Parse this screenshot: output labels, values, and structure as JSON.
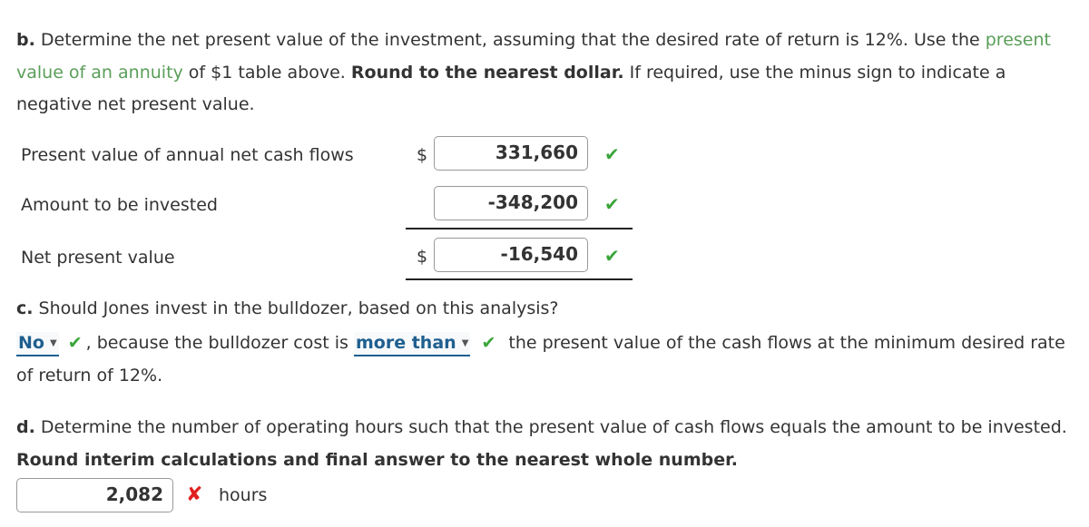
{
  "part_b": {
    "label": "b.",
    "text_1": " Determine the net present value of the investment, assuming that the desired rate of return is 12%. Use the ",
    "link": "present value of an annuity",
    "text_2": " of $1 table above. ",
    "bold": "Round to the nearest dollar.",
    "text_3": " If required, use the minus sign to indicate a negative net present value.",
    "rows": [
      {
        "label": "Present value of annual net cash flows",
        "currency": "$",
        "value": "331,660",
        "status": "correct"
      },
      {
        "label": "Amount to be invested",
        "currency": "",
        "value": "-348,200",
        "status": "correct"
      },
      {
        "label": "Net present value",
        "currency": "$",
        "value": "-16,540",
        "status": "correct"
      }
    ],
    "check_icon": "✔"
  },
  "part_c": {
    "label": "c.",
    "question": " Should Jones invest in the bulldozer, based on this analysis?",
    "dropdown_1": {
      "selected": "No",
      "status": "correct"
    },
    "text_1": ", because the bulldozer cost is ",
    "dropdown_2": {
      "selected": "more than",
      "status": "correct"
    },
    "text_2": " the present value of the cash flows at the minimum desired rate of return of 12%."
  },
  "part_d": {
    "label": "d.",
    "text_1": " Determine the number of operating hours such that the present value of cash flows equals the amount to be invested. ",
    "bold": "Round interim calculations and final answer to the nearest whole number.",
    "answer": "2,082",
    "status": "incorrect",
    "x_icon": "✘",
    "unit": "hours"
  },
  "colors": {
    "correct": "#3aa53a",
    "incorrect": "#e02020",
    "link": "#5a9e5a",
    "dropdown": "#1f5f8f"
  }
}
